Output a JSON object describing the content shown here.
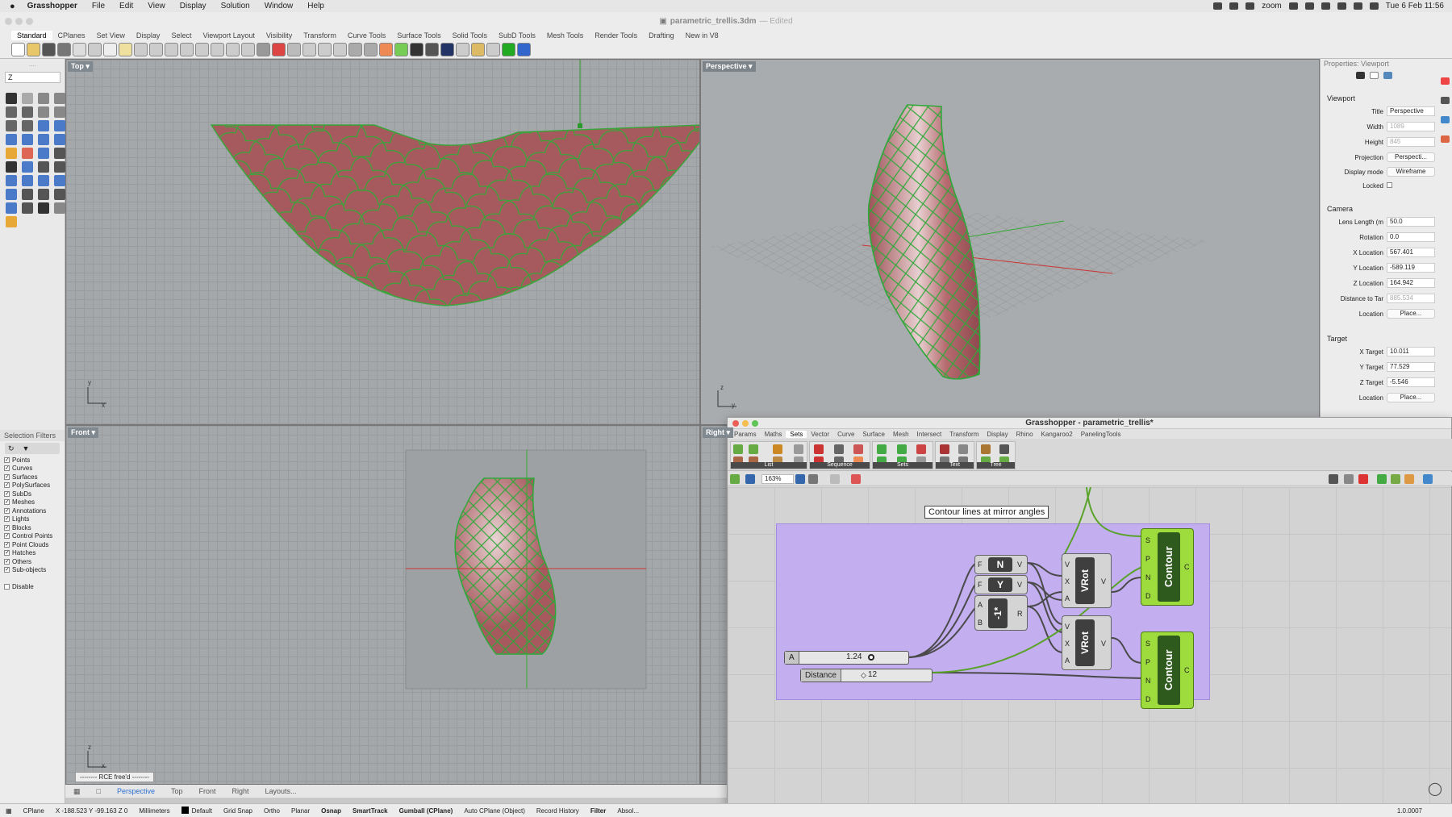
{
  "menubar": {
    "app_name": "Grasshopper",
    "items": [
      "File",
      "Edit",
      "View",
      "Display",
      "Solution",
      "Window",
      "Help"
    ],
    "zoom_label": "zoom",
    "datetime": "Tue 6 Feb  11:56"
  },
  "window": {
    "title": "parametric_trellis.3dm",
    "title_suffix": "— Edited"
  },
  "toolbar_tabs": [
    "Standard",
    "CPlanes",
    "Set View",
    "Display",
    "Select",
    "Viewport Layout",
    "Visibility",
    "Transform",
    "Curve Tools",
    "Surface Tools",
    "Solid Tools",
    "SubD Tools",
    "Mesh Tools",
    "Render Tools",
    "Drafting",
    "New in V8"
  ],
  "command_line": "Z",
  "viewports": {
    "top": {
      "label": "Top"
    },
    "perspective": {
      "label": "Perspective"
    },
    "front": {
      "label": "Front"
    },
    "right": {
      "label": "Right"
    }
  },
  "viewport_tabs": [
    "Perspective",
    "Top",
    "Front",
    "Right",
    "Layouts..."
  ],
  "rce_note": "-------- RCE free'd --------",
  "selection_filters": {
    "title": "Selection Filters",
    "items": [
      {
        "label": "Points",
        "checked": true
      },
      {
        "label": "Curves",
        "checked": true
      },
      {
        "label": "Surfaces",
        "checked": true
      },
      {
        "label": "PolySurfaces",
        "checked": true
      },
      {
        "label": "SubDs",
        "checked": true
      },
      {
        "label": "Meshes",
        "checked": true
      },
      {
        "label": "Annotations",
        "checked": true
      },
      {
        "label": "Lights",
        "checked": true
      },
      {
        "label": "Blocks",
        "checked": true
      },
      {
        "label": "Control Points",
        "checked": true
      },
      {
        "label": "Point Clouds",
        "checked": true
      },
      {
        "label": "Hatches",
        "checked": true
      },
      {
        "label": "Others",
        "checked": true
      },
      {
        "label": "Sub-objects",
        "checked": true
      }
    ],
    "disable_label": "Disable"
  },
  "properties": {
    "title": "Properties: Viewport",
    "viewport_section": "Viewport",
    "title_label": "Title",
    "title_value": "Perspective",
    "width_label": "Width",
    "width_value": "1089",
    "height_label": "Height",
    "height_value": "845",
    "projection_label": "Projection",
    "projection_value": "Perspecti...",
    "display_mode_label": "Display mode",
    "display_mode_value": "Wireframe",
    "locked_label": "Locked",
    "camera_section": "Camera",
    "lens_label": "Lens Length (m",
    "lens_value": "50.0",
    "rotation_label": "Rotation",
    "rotation_value": "0.0",
    "xloc_label": "X Location",
    "xloc_value": "567.401",
    "yloc_label": "Y Location",
    "yloc_value": "-589.119",
    "zloc_label": "Z Location",
    "zloc_value": "164.942",
    "dist_label": "Distance to Tar",
    "dist_value": "885.534",
    "location_label": "Location",
    "place_button": "Place...",
    "target_section": "Target",
    "xt_label": "X Target",
    "xt_value": "10.011",
    "yt_label": "Y Target",
    "yt_value": "77.529",
    "zt_label": "Z Target",
    "zt_value": "-5.546",
    "tloc_label": "Location",
    "tplace_button": "Place..."
  },
  "grasshopper": {
    "title": "Grasshopper - parametric_trellis*",
    "tabs": [
      "Params",
      "Maths",
      "Sets",
      "Vector",
      "Curve",
      "Surface",
      "Mesh",
      "Intersect",
      "Transform",
      "Display",
      "Rhino",
      "Kangaroo2",
      "PanelingTools"
    ],
    "active_tab": "Sets",
    "ribbon_groups": [
      "List",
      "Sequence",
      "Sets",
      "Text",
      "Tree"
    ],
    "zoom": "163%",
    "group_label": "Contour lines at mirror angles",
    "components": {
      "n": {
        "name": "N",
        "in": [
          "F"
        ],
        "out": [
          "V"
        ]
      },
      "y": {
        "name": "Y",
        "in": [
          "F"
        ],
        "out": [
          "V"
        ]
      },
      "neg": {
        "name": "-1*",
        "in": [
          "A",
          "B"
        ],
        "out": [
          "R"
        ]
      },
      "vrot1": {
        "name": "VRot",
        "in": [
          "V",
          "X",
          "A"
        ],
        "out": [
          "V"
        ]
      },
      "vrot2": {
        "name": "VRot",
        "in": [
          "V",
          "X",
          "A"
        ],
        "out": [
          "V"
        ]
      },
      "contour1": {
        "name": "Contour",
        "in": [
          "S",
          "P",
          "N",
          "D"
        ],
        "out": [
          "C"
        ]
      },
      "contour2": {
        "name": "Contour",
        "in": [
          "S",
          "P",
          "N",
          "D"
        ],
        "out": [
          "C"
        ]
      }
    },
    "slider_a": {
      "label": "A",
      "value": "1.24"
    },
    "slider_distance": {
      "label": "Distance",
      "value": "12"
    },
    "version_value": "1.0.0007"
  },
  "statusbar": {
    "cplane": "CPlane",
    "coords": "X -188.523 Y -99.163 Z 0",
    "units": "Millimeters",
    "layer": "Default",
    "grid_snap": "Grid Snap",
    "ortho": "Ortho",
    "planar": "Planar",
    "osnap": "Osnap",
    "smarttrack": "SmartTrack",
    "gumball": "Gumball (CPlane)",
    "autocplane": "Auto CPlane (Object)",
    "record_history": "Record History",
    "filter": "Filter",
    "absolute": "Absol..."
  },
  "colors": {
    "surface": "#a65a5e",
    "contour": "#3aa53a",
    "group": "#c3aef0",
    "component_green": "#9ddc3c"
  }
}
